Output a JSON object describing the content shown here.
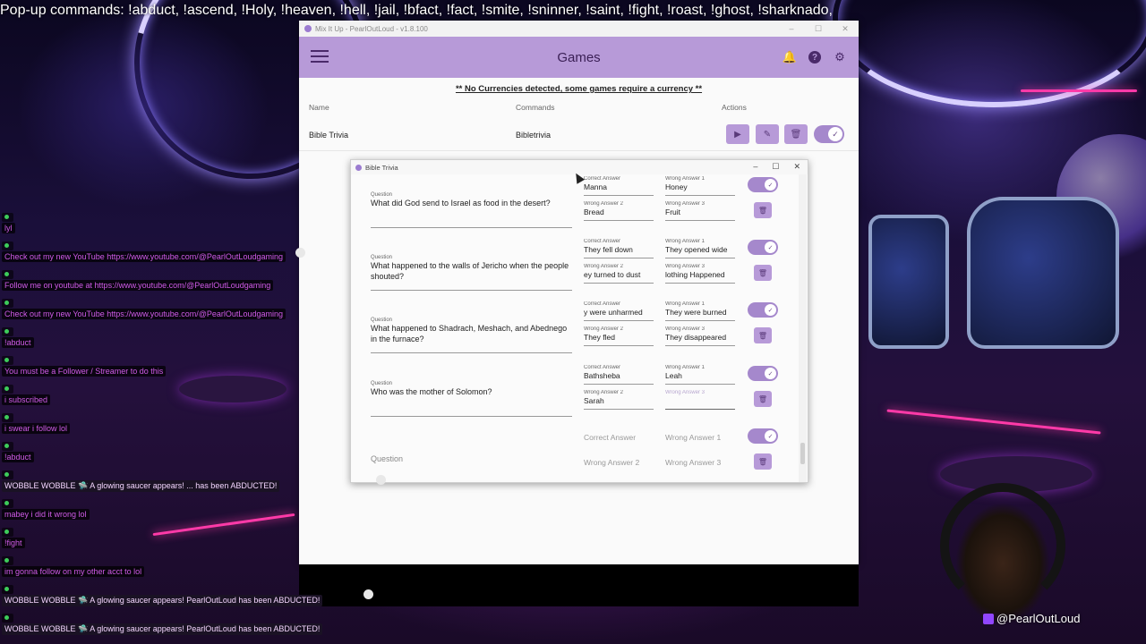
{
  "overlay": {
    "ticker": "Pop-up commands: !abduct, !ascend, !Holy, !heaven, !hell,  !jail, !bfact, !fact, !smite, !sninner, !saint, !fight, !roast, !ghost, !sharknado,",
    "handle": "@PearlOutLoud"
  },
  "app": {
    "window_title": "Mix It Up - PearlOutLoud - v1.8.100",
    "page_title": "Games",
    "notice": "** No Currencies detected, some games require a currency **",
    "columns": {
      "name": "Name",
      "commands": "Commands",
      "actions": "Actions"
    },
    "game": {
      "name": "Bible Trivia",
      "command": "Bibletrivia",
      "enabled": true
    }
  },
  "dialog": {
    "title": "Bible Trivia",
    "labels": {
      "question": "Question",
      "correct": "Correct Answer",
      "wrong1": "Wrong Answer 1",
      "wrong2": "Wrong Answer 2",
      "wrong3": "Wrong Answer 3"
    },
    "questions": [
      {
        "question": "What did God send to Israel as food in the desert?",
        "correct": "Manna",
        "wrong1": "Honey",
        "wrong2": "Bread",
        "wrong3": "Fruit",
        "enabled": true
      },
      {
        "question": "What happened to the walls of Jericho when the people shouted?",
        "correct": "They fell down",
        "wrong1": "They opened wide",
        "wrong2": "ey turned to dust",
        "wrong3": "lothing Happened",
        "enabled": true
      },
      {
        "question": "What happened to Shadrach, Meshach, and Abednego in the furnace?",
        "correct": "y were unharmed",
        "wrong1": "They were burned",
        "wrong2": "They fled",
        "wrong3": "They disappeared",
        "enabled": true
      },
      {
        "question": "Who was the mother of Solomon?",
        "correct": "Bathsheba",
        "wrong1": "Leah",
        "wrong2": "Sarah",
        "wrong3": "",
        "enabled": true
      },
      {
        "question": "",
        "correct": "",
        "wrong1": "",
        "wrong2": "",
        "wrong3": "",
        "enabled": true
      }
    ]
  },
  "chat": [
    {
      "user": "",
      "text": "lyl"
    },
    {
      "user": "",
      "text": "Check out my new YouTube https://www.youtube.com/@PearlOutLoudgaming"
    },
    {
      "user": "",
      "text": "Follow me on youtube at https://www.youtube.com/@PearlOutLoudgaming"
    },
    {
      "user": "",
      "text": "Check out my new YouTube https://www.youtube.com/@PearlOutLoudgaming"
    },
    {
      "user": "",
      "text": "!abduct"
    },
    {
      "user": "",
      "text": "You must be a Follower / Streamer to do this"
    },
    {
      "user": "",
      "text": "i subscribed"
    },
    {
      "user": "",
      "text": "i swear i follow lol"
    },
    {
      "user": "",
      "text": "!abduct"
    },
    {
      "user": "",
      "text": "WOBBLE WOBBLE 🛸 A glowing saucer appears! ... has been ABDUCTED!",
      "alert": true
    },
    {
      "user": "",
      "text": "mabey i did it wrong lol"
    },
    {
      "user": "",
      "text": "!fight"
    },
    {
      "user": "",
      "text": "im gonna follow on my other acct to lol"
    },
    {
      "user": "",
      "text": "WOBBLE WOBBLE 🛸 A glowing saucer appears! PearlOutLoud has been ABDUCTED!",
      "alert": true
    },
    {
      "user": "",
      "text": "WOBBLE WOBBLE 🛸 A glowing saucer appears! PearlOutLoud has been ABDUCTED!",
      "alert": true
    }
  ]
}
